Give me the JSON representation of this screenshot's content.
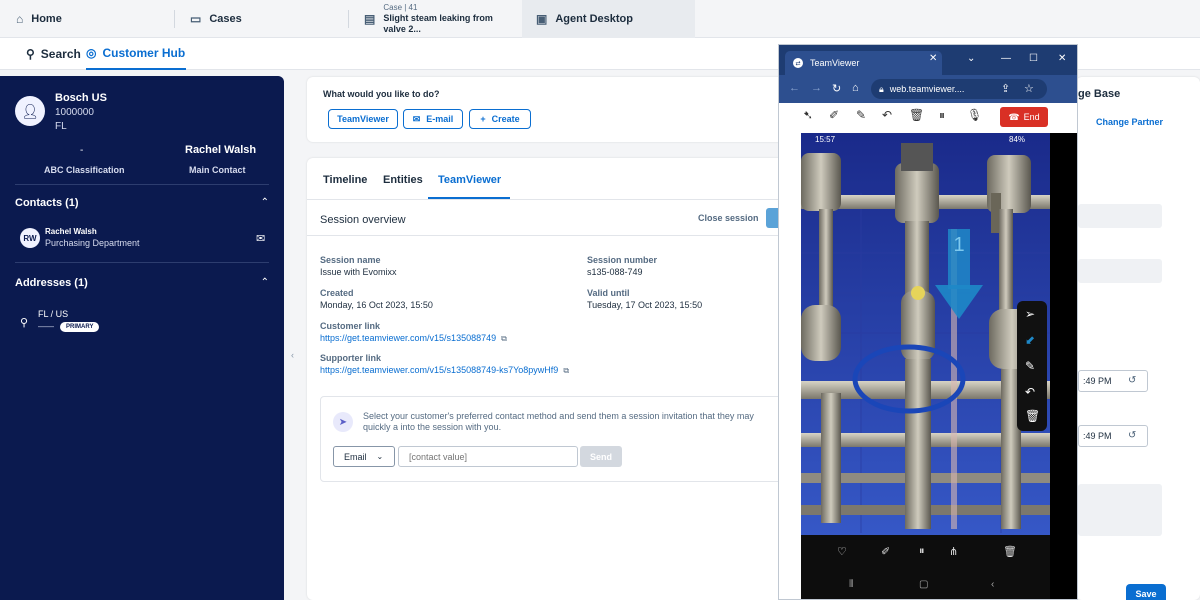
{
  "top_tabs": {
    "home": "Home",
    "cases": "Cases",
    "case_number": "Case | 41",
    "case_title": "Slight steam leaking from valve 2...",
    "agent_desktop": "Agent Desktop"
  },
  "sub_nav": {
    "search": "Search",
    "customer_hub": "Customer Hub"
  },
  "account": {
    "name": "Bosch US",
    "id": "1000000",
    "region": "FL",
    "classification_value": "-",
    "main_contact_name": "Rachel Walsh",
    "classification_label": "ABC Classification",
    "main_contact_label": "Main Contact"
  },
  "contacts": {
    "header": "Contacts (1)",
    "items": [
      {
        "initials": "RW",
        "name": "Rachel Walsh",
        "department": "Purchasing Department"
      }
    ]
  },
  "addresses": {
    "header": "Addresses (1)",
    "items": [
      {
        "line": "FL / US",
        "dash": "——",
        "badge": "PRIMARY"
      }
    ]
  },
  "actions": {
    "title": "What would you like to do?",
    "teamviewer": "TeamViewer",
    "email": "E-mail",
    "create": "Create"
  },
  "content_tabs": {
    "timeline": "Timeline",
    "entities": "Entities",
    "teamviewer": "TeamViewer"
  },
  "session": {
    "overview_title": "Session overview",
    "close_session": "Close session",
    "name_label": "Session name",
    "name_value": "Issue with Evomixx",
    "number_label": "Session number",
    "number_value": "s135-088-749",
    "created_label": "Created",
    "created_value": "Monday, 16 Oct 2023, 15:50",
    "valid_label": "Valid until",
    "valid_value": "Tuesday, 17 Oct 2023, 15:50",
    "customer_link_label": "Customer link",
    "customer_link": "https://get.teamviewer.com/v15/s135088749",
    "supporter_link_label": "Supporter link",
    "supporter_link": "https://get.teamviewer.com/v15/s135088749-ks7Yo8pywHf9",
    "invite_text": "Select your customer's preferred contact method and send them a session invitation that they may quickly a into the session with you.",
    "method_selected": "Email",
    "contact_placeholder": "[contact value]",
    "send": "Send"
  },
  "right_panel": {
    "title": "ge Base",
    "change_partner": "Change Partner",
    "time1": ":49 PM",
    "time2": ":49 PM",
    "save": "Save"
  },
  "teamviewer_window": {
    "tab_title": "TeamViewer",
    "url": "web.teamviewer....",
    "end": "End",
    "phone_time": "15:57",
    "phone_battery": "84%",
    "marker_number": "1"
  },
  "colors": {
    "accent": "#0a6ed1",
    "navy_panel": "#0b1a4f",
    "end_red": "#d93025",
    "tv_blue": "#1e3c72"
  }
}
